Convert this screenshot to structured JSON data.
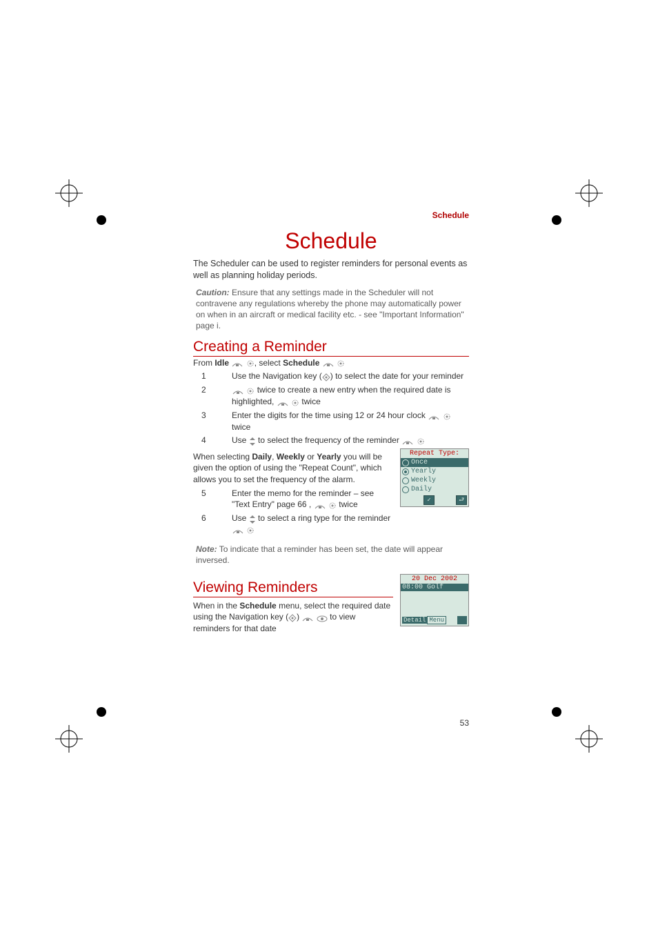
{
  "running_head": "Schedule",
  "title": "Schedule",
  "intro": "The Scheduler can be used to register reminders for personal events as well as planning holiday periods.",
  "caution": {
    "label": "Caution:",
    "text": " Ensure that any settings made in the Scheduler will not contravene any regulations whereby the phone may automatically power on when in an aircraft or medical facility etc. - see \"Important Information\" page i."
  },
  "section1": {
    "heading": "Creating a Reminder",
    "from_prefix": "From ",
    "from_idle": "Idle",
    "from_middle": ", select ",
    "from_schedule": "Schedule",
    "steps_a": [
      {
        "num": "1",
        "text": "Use the Navigation key (",
        "text2": ") to select the date for your reminder"
      },
      {
        "num": "2",
        "text_a": "twice to create a new entry when the required date is highlighted, ",
        "text_b": " twice"
      },
      {
        "num": "3",
        "text": "Enter the digits for the time using 12 or 24 hour clock ",
        "text2": " twice"
      },
      {
        "num": "4",
        "text": "Use ",
        "text2": " to select the frequency of the reminder "
      }
    ],
    "mid_para_a": "When selecting ",
    "mid_daily": "Daily",
    "mid_sep1": ", ",
    "mid_weekly": "Weekly",
    "mid_sep2": " or ",
    "mid_yearly": "Yearly",
    "mid_para_b": " you will be given the option of using the \"Repeat Count\", which allows you to set the frequency of the alarm.",
    "steps_b": [
      {
        "num": "5",
        "text": "Enter the memo for the reminder – see \"Text Entry\" page 66 ,  ",
        "text2": " twice"
      },
      {
        "num": "6",
        "text": "Use ",
        "text2": " to select a ring type for the reminder "
      }
    ]
  },
  "note": {
    "label": "Note:",
    "text": " To indicate that a reminder has been set, the date will appear inversed."
  },
  "section2": {
    "heading": "Viewing Reminders",
    "para_a": "When in the ",
    "para_schedule": "Schedule",
    "para_b": " menu, select the required date using the Navigation key (",
    "para_c": ") ",
    "para_d": "  to view reminders for that date"
  },
  "screen1": {
    "title": "Repeat Type:",
    "options": [
      "Once",
      "Yearly",
      "Weekly",
      "Daily"
    ],
    "selected_index": 0,
    "yearly_filled": true
  },
  "screen2": {
    "date": "20 Dec 2002",
    "entry": "08:00 Golf",
    "left_soft": "Detail",
    "right_soft": "Menu"
  },
  "page_number": "53"
}
